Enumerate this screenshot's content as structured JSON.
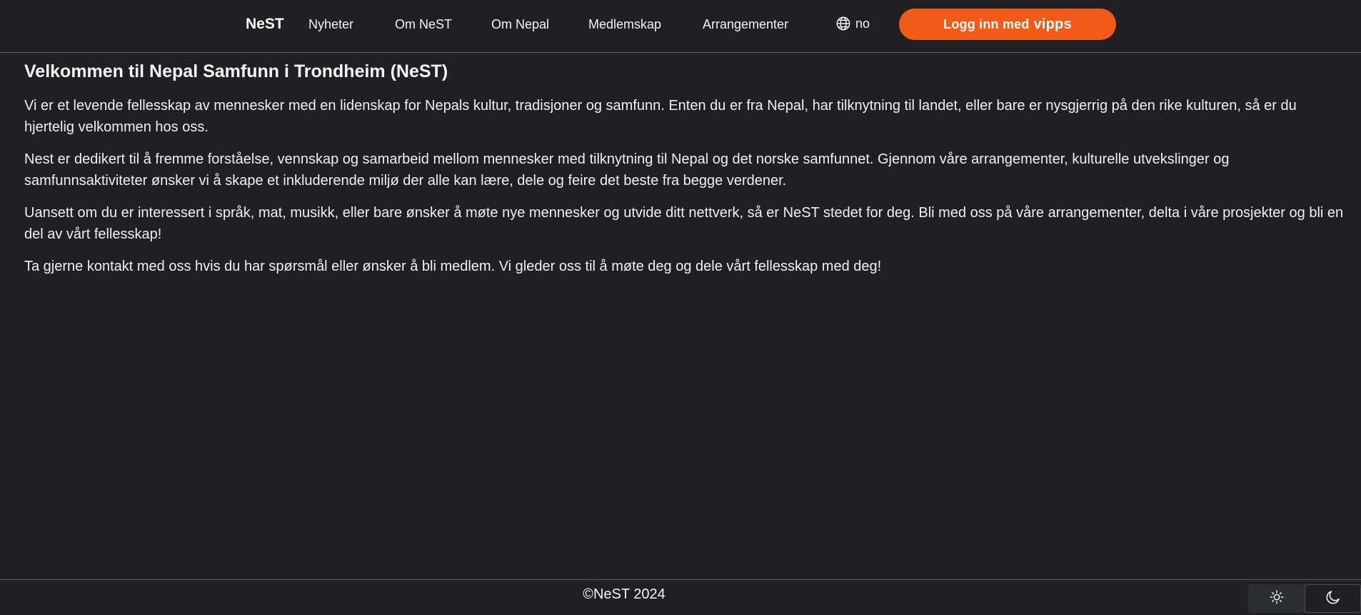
{
  "header": {
    "brand": "NeST",
    "nav": [
      {
        "label": "Nyheter"
      },
      {
        "label": "Om NeST"
      },
      {
        "label": "Om Nepal"
      },
      {
        "label": "Medlemskap"
      },
      {
        "label": "Arrangementer"
      }
    ],
    "language": {
      "icon": "globe-icon",
      "value": "no"
    },
    "login": {
      "label": "Logg inn med",
      "brand": "vipps",
      "color": "#f25a18"
    }
  },
  "main": {
    "title": "Velkommen til Nepal Samfunn i Trondheim (NeST)",
    "paragraphs": [
      "Vi er et levende fellesskap av mennesker med en lidenskap for Nepals kultur, tradisjoner og samfunn. Enten du er fra Nepal, har tilknytning til landet, eller bare er nysgjerrig på den rike kulturen, så er du hjertelig velkommen hos oss.",
      "Nest er dedikert til å fremme forståelse, vennskap og samarbeid mellom mennesker med tilknytning til Nepal og det norske samfunnet. Gjennom våre arrangementer, kulturelle utvekslinger og samfunnsaktiviteter ønsker vi å skape et inkluderende miljø der alle kan lære, dele og feire det beste fra begge verdener.",
      "Uansett om du er interessert i språk, mat, musikk, eller bare ønsker å møte nye mennesker og utvide ditt nettverk, så er NeST stedet for deg. Bli med oss på våre arrangementer, delta i våre prosjekter og bli en del av vårt fellesskap!",
      "Ta gjerne kontakt med oss hvis du har spørsmål eller ønsker å bli medlem. Vi gleder oss til å møte deg og dele vårt fellesskap med deg!"
    ]
  },
  "footer": {
    "copyright": "©NeST 2024",
    "theme": {
      "light_icon": "sun-icon",
      "dark_icon": "moon-icon",
      "active": "dark"
    }
  },
  "colors": {
    "background": "#1e2024",
    "accent": "#f25a18",
    "text": "#f2f3f5",
    "divider": "#5a5d63"
  }
}
